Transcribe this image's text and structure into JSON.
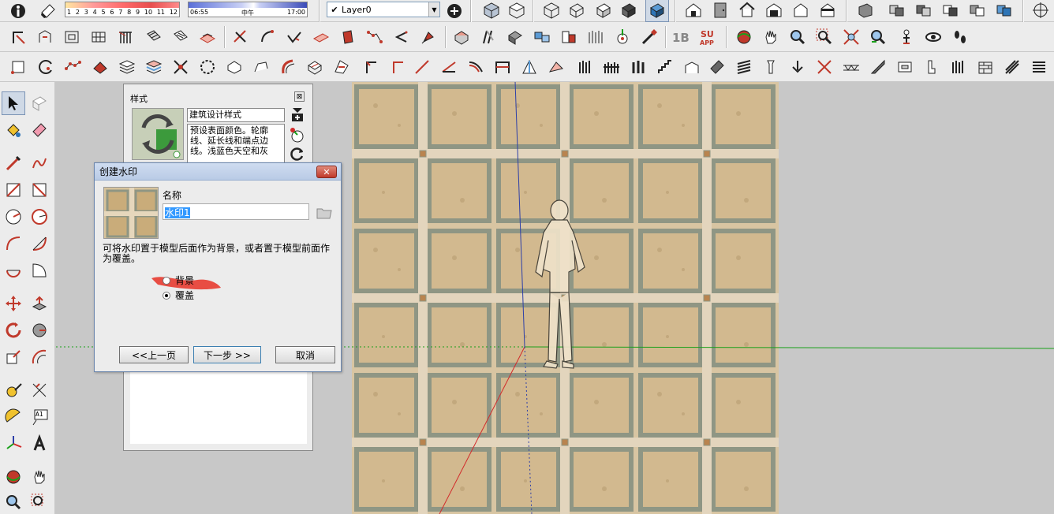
{
  "toolbar": {
    "shadow_ramp_labels": [
      "1",
      "2",
      "3",
      "4",
      "5",
      "6",
      "7",
      "8",
      "9",
      "10",
      "11",
      "12"
    ],
    "time_start": "06:55",
    "time_mid": "中午",
    "time_end": "17:00",
    "layer_check": "✔",
    "layer_value": "Layer0",
    "dropdown_arrow": "▼"
  },
  "styles_panel": {
    "title": "样式",
    "close_symbol": "⊠",
    "style_name": "建筑设计样式",
    "style_description": "预设表面颜色。轮廓线、延长线和端点边线。浅蓝色天空和灰"
  },
  "dialog": {
    "title": "创建水印",
    "close_symbol": "✕",
    "name_label": "名称",
    "name_value": "水印1",
    "hint": "可将水印置于模型后面作为背景，或者置于模型前面作为覆盖。",
    "radio_background": "背景",
    "radio_overlay": "覆盖",
    "selected_option": "overlay",
    "btn_back": "<<上一页",
    "btn_next": "下一步 >>",
    "btn_cancel": "取消"
  },
  "left_palette": {
    "text_tool_label": "A1"
  },
  "colors": {
    "axis_red": "#d22b2b",
    "axis_green": "#19a019",
    "axis_blue": "#2d3fa8",
    "texture_base": "#d9c7a6",
    "grout": "#9aa08f"
  },
  "icons": {
    "row1": [
      "cube-solid-icon",
      "paint-bucket-icon",
      "components-icon",
      "materials-icon",
      "house-icon",
      "door-icon",
      "warehouse-icon",
      "section-plane-icon"
    ],
    "row2": [
      "dimension-icon",
      "follow-me-icon",
      "scale-icon",
      "offset-icon",
      "push-pull-icon",
      "tape-measure-icon",
      "rotate-icon",
      "zoom-icon",
      "walk-icon",
      "look-around-icon"
    ],
    "row3": [
      "circle-icon",
      "arc-icon",
      "polygon-icon",
      "bezier-icon",
      "stairs-icon",
      "railing-icon",
      "roof-icon",
      "wall-icon"
    ]
  }
}
